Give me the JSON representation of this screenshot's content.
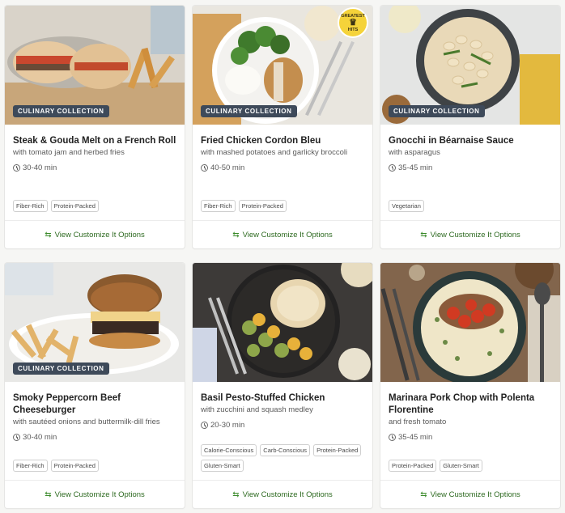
{
  "recipes": [
    {
      "title": "Steak & Gouda Melt on a French Roll",
      "subtitle": "with tomato jam and herbed fries",
      "time": "30-40 min",
      "badge": "CULINARY COLLECTION",
      "tags": [
        "Fiber-Rich",
        "Protein-Packed"
      ],
      "cta": "View Customize It Options"
    },
    {
      "title": "Fried Chicken Cordon Bleu",
      "subtitle": "with mashed potatoes and garlicky broccoli",
      "time": "40-50 min",
      "badge": "CULINARY COLLECTION",
      "hits_top": "GREATEST",
      "hits_bottom": "HITS",
      "tags": [
        "Fiber-Rich",
        "Protein-Packed"
      ],
      "cta": "View Customize It Options"
    },
    {
      "title": "Gnocchi in Béarnaise Sauce",
      "subtitle": "with asparagus",
      "time": "35-45 min",
      "badge": "CULINARY COLLECTION",
      "tags": [
        "Vegetarian"
      ],
      "cta": "View Customize It Options"
    },
    {
      "title": "Smoky Peppercorn Beef Cheeseburger",
      "subtitle": "with sautéed onions and buttermilk-dill fries",
      "time": "30-40 min",
      "badge": "CULINARY COLLECTION",
      "tags": [
        "Fiber-Rich",
        "Protein-Packed"
      ],
      "cta": "View Customize It Options"
    },
    {
      "title": "Basil Pesto-Stuffed Chicken",
      "subtitle": "with zucchini and squash medley",
      "time": "20-30 min",
      "tags": [
        "Calorie-Conscious",
        "Carb-Conscious",
        "Protein-Packed",
        "Gluten-Smart"
      ],
      "cta": "View Customize It Options"
    },
    {
      "title": "Marinara Pork Chop with Polenta Florentine",
      "subtitle": "and fresh tomato",
      "time": "35-45 min",
      "tags": [
        "Protein-Packed",
        "Gluten-Smart"
      ],
      "cta": "View Customize It Options"
    }
  ],
  "colors": {
    "cta_green": "#2f6b22",
    "badge_bg": "#3e4a5a",
    "hits_yellow": "#f5d33a"
  },
  "icons": {
    "time": "clock-icon",
    "cta": "swap-arrows-icon",
    "hits": "crown-icon"
  }
}
